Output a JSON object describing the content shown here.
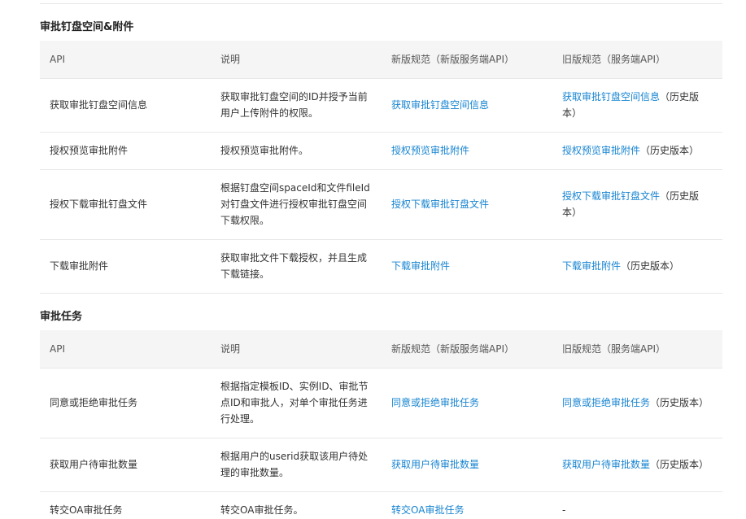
{
  "sections": [
    {
      "title": "审批钉盘空间&附件",
      "headers": [
        "API",
        "说明",
        "新版规范（新版服务端API）",
        "旧版规范（服务端API）"
      ],
      "rows": [
        {
          "api": "获取审批钉盘空间信息",
          "desc": "获取审批钉盘空间的ID并授予当前用户上传附件的权限。",
          "new_link": "获取审批钉盘空间信息",
          "old_link": "获取审批钉盘空间信息",
          "old_suffix": "（历史版本）"
        },
        {
          "api": "授权预览审批附件",
          "desc": "授权预览审批附件。",
          "new_link": "授权预览审批附件",
          "old_link": "授权预览审批附件",
          "old_suffix": "（历史版本）"
        },
        {
          "api": "授权下载审批钉盘文件",
          "desc": "根据钉盘空间spaceId和文件fileId对钉盘文件进行授权审批钉盘空间下载权限。",
          "new_link": "授权下载审批钉盘文件",
          "old_link": "授权下载审批钉盘文件",
          "old_suffix": "（历史版本）"
        },
        {
          "api": "下载审批附件",
          "desc": "获取审批文件下载授权，并且生成下载链接。",
          "new_link": "下载审批附件",
          "old_link": "下载审批附件",
          "old_suffix": "（历史版本）"
        }
      ]
    },
    {
      "title": "审批任务",
      "headers": [
        "API",
        "说明",
        "新版规范（新版服务端API）",
        "旧版规范（服务端API）"
      ],
      "rows": [
        {
          "api": "同意或拒绝审批任务",
          "desc": "根据指定模板ID、实例ID、审批节点ID和审批人，对单个审批任务进行处理。",
          "new_link": "同意或拒绝审批任务",
          "old_link": "同意或拒绝审批任务",
          "old_suffix": "（历史版本）"
        },
        {
          "api": "获取用户待审批数量",
          "desc": "根据用户的userid获取该用户待处理的审批数量。",
          "new_link": "获取用户待审批数量",
          "old_link": "获取用户待审批数量",
          "old_suffix": "（历史版本）"
        },
        {
          "api": "转交OA审批任务",
          "desc": "转交OA审批任务。",
          "new_link": "转交OA审批任务",
          "old_link": "",
          "old_suffix": "-"
        }
      ]
    }
  ],
  "colors": {
    "link": "#1784d1",
    "header_bg": "#f5f5f6",
    "border": "#e8e8e8"
  }
}
